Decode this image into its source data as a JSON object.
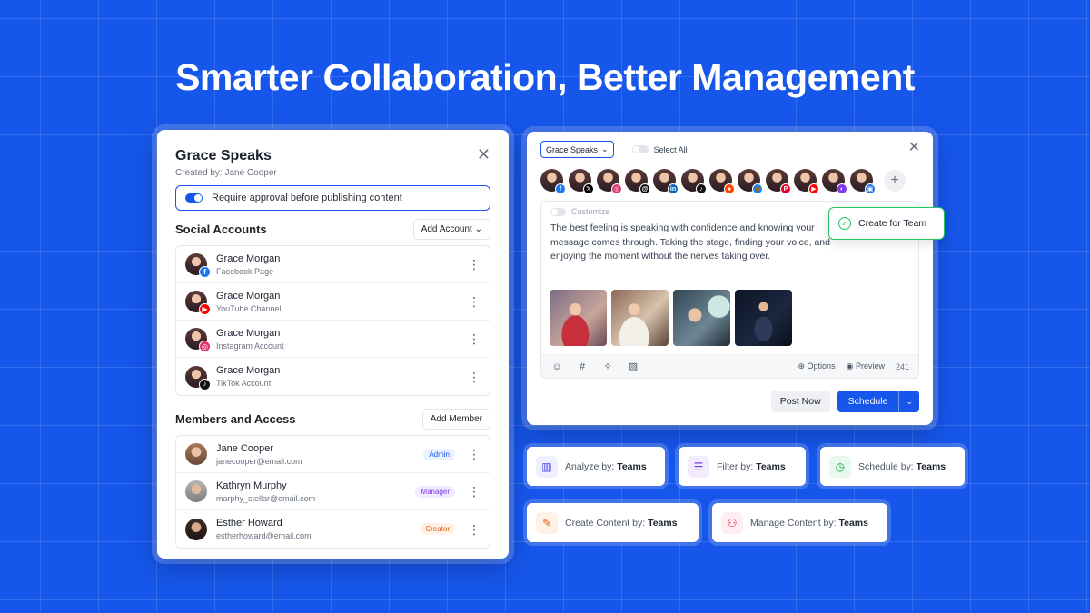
{
  "headline": "Smarter Collaboration, Better Management",
  "team_panel": {
    "title": "Grace Speaks",
    "created_by": "Created by: Jane Cooper",
    "approval_label": "Require approval before publishing content",
    "social_title": "Social Accounts",
    "add_account": "Add Account",
    "accounts": [
      {
        "name": "Grace Morgan",
        "type": "Facebook Page",
        "badge": "f",
        "color": "#1877f2"
      },
      {
        "name": "Grace Morgan",
        "type": "YouTube Channel",
        "badge": "▶",
        "color": "#ff0000"
      },
      {
        "name": "Grace Morgan",
        "type": "Instagram Account",
        "badge": "◎",
        "color": "#e1306c"
      },
      {
        "name": "Grace Morgan",
        "type": "TikTok Account",
        "badge": "♪",
        "color": "#111111"
      }
    ],
    "members_title": "Members and Access",
    "add_member": "Add Member",
    "members": [
      {
        "name": "Jane Cooper",
        "email": "janecooper@email.com",
        "role": "Admin",
        "role_class": "admin"
      },
      {
        "name": "Kathryn Murphy",
        "email": "marphy_stellar@email.com",
        "role": "Manager",
        "role_class": "manager"
      },
      {
        "name": "Esther Howard",
        "email": "estherhoward@email.com",
        "role": "Creator",
        "role_class": "creator"
      }
    ]
  },
  "composer": {
    "workspace": "Grace Speaks",
    "select_all": "Select All",
    "customize": "Customize",
    "post_text": "The best feeling is speaking with confidence and knowing your message comes through. Taking the stage, finding your voice, and enjoying the moment without the nerves taking over.",
    "accounts": [
      {
        "badge": "f",
        "color": "#1877f2"
      },
      {
        "badge": "𝕏",
        "color": "#000000"
      },
      {
        "badge": "◎",
        "color": "#e1306c"
      },
      {
        "badge": "@",
        "color": "#111111"
      },
      {
        "badge": "in",
        "color": "#0a66c2"
      },
      {
        "badge": "♪",
        "color": "#111111"
      },
      {
        "badge": "●",
        "color": "#ff4500"
      },
      {
        "badge": "🦋",
        "color": "#1185fe"
      },
      {
        "badge": "P",
        "color": "#e60023"
      },
      {
        "badge": "▶",
        "color": "#ff0000"
      },
      {
        "badge": "◐",
        "color": "#7c3aed"
      },
      {
        "badge": "▣",
        "color": "#1a73e8"
      }
    ],
    "options": "Options",
    "preview": "Preview",
    "char_count": "241",
    "tooltip": "Create for Team",
    "post_now": "Post Now",
    "schedule": "Schedule"
  },
  "features": [
    {
      "prefix": "Analyze by: ",
      "bold": "Teams",
      "icon": "bar-chart-icon",
      "glyph": "▥",
      "color": "#4f46e5",
      "bg": "#eef0ff"
    },
    {
      "prefix": "Filter by: ",
      "bold": "Teams",
      "icon": "filter-icon",
      "glyph": "☰",
      "color": "#7c3aed",
      "bg": "#f3ecff"
    },
    {
      "prefix": "Schedule by: ",
      "bold": "Teams",
      "icon": "clock-icon",
      "glyph": "◷",
      "color": "#16a34a",
      "bg": "#e9f8ee"
    },
    {
      "prefix": "Create Content by: ",
      "bold": "Teams",
      "icon": "pencil-icon",
      "glyph": "✎",
      "color": "#ea580c",
      "bg": "#fff1e6"
    },
    {
      "prefix": "Manage Content by: ",
      "bold": "Teams",
      "icon": "users-icon",
      "glyph": "⚇",
      "color": "#e11d48",
      "bg": "#ffedf1"
    }
  ]
}
